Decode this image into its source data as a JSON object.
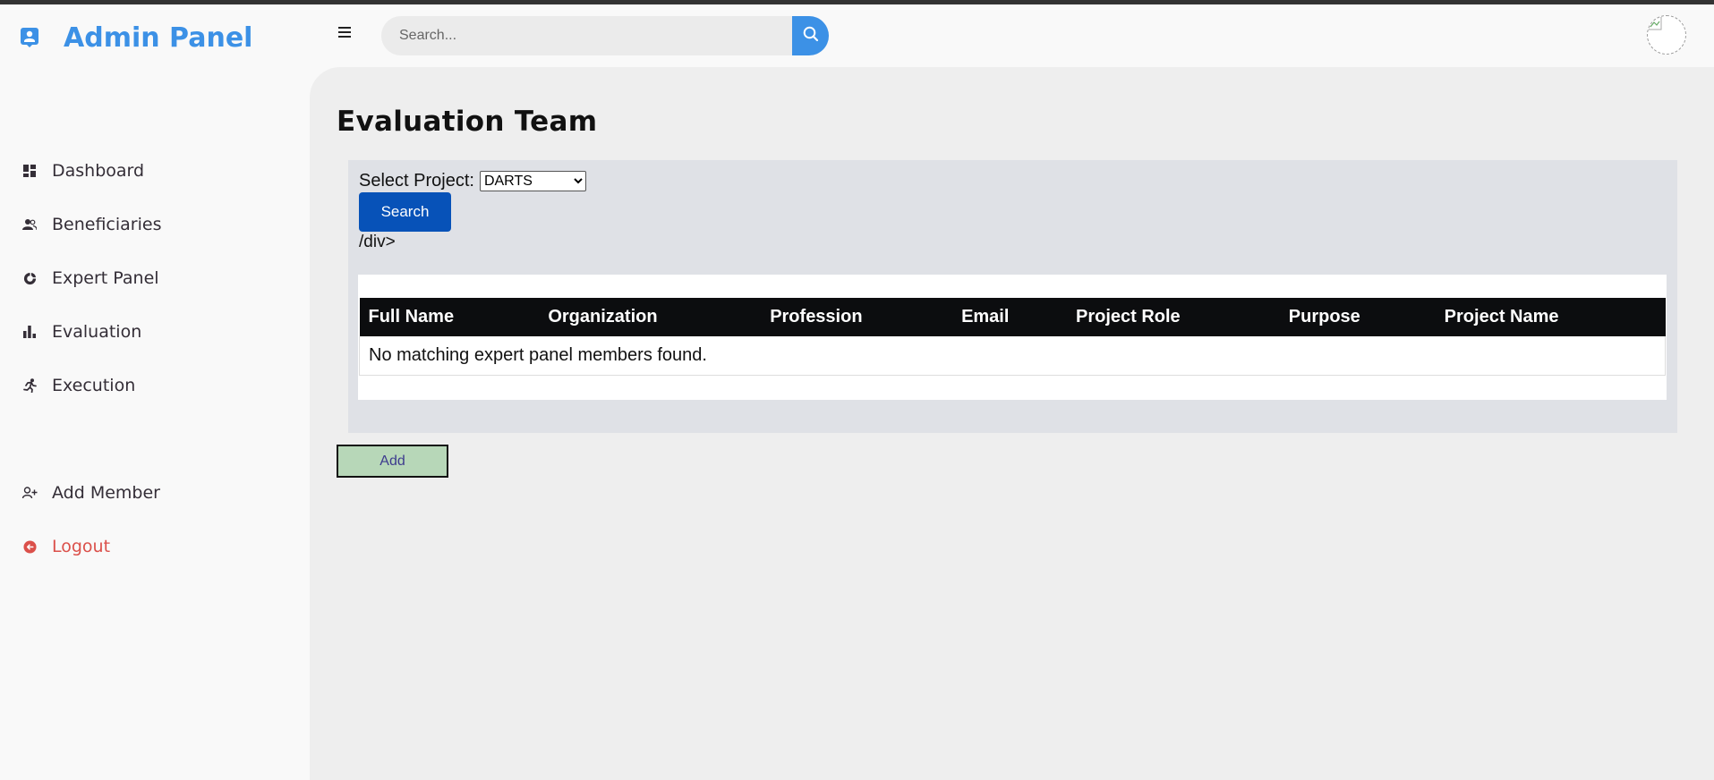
{
  "brand": {
    "title": "Admin Panel",
    "icon": "user-badge-icon"
  },
  "sidebar": {
    "items": [
      {
        "label": "Dashboard",
        "icon": "dashboard-icon"
      },
      {
        "label": "Beneficiaries",
        "icon": "people-icon"
      },
      {
        "label": "Expert Panel",
        "icon": "pie-chart-icon"
      },
      {
        "label": "Evaluation",
        "icon": "bar-chart-icon"
      },
      {
        "label": "Execution",
        "icon": "running-icon"
      }
    ],
    "bottom_items": [
      {
        "label": "Add Member",
        "icon": "add-user-icon"
      },
      {
        "label": "Logout",
        "icon": "logout-icon",
        "color": "#db504a"
      }
    ]
  },
  "topbar": {
    "search_placeholder": "Search...",
    "search_icon": "search-icon",
    "menu_icon": "hamburger-icon"
  },
  "page": {
    "title": "Evaluation Team",
    "select_label": "Select Project:",
    "selected_project": "DARTS",
    "search_button": "Search",
    "stray_text": "/div>",
    "add_button": "Add"
  },
  "table": {
    "columns": [
      "Full Name",
      "Organization",
      "Profession",
      "Email",
      "Project Role",
      "Purpose",
      "Project Name"
    ],
    "empty_message": "No matching expert panel members found."
  },
  "colors": {
    "accent": "#3c91e6",
    "primary_button": "#0752b8",
    "add_button": "#b7d7b8",
    "table_header": "#0c0d0f",
    "logout": "#db504a"
  }
}
